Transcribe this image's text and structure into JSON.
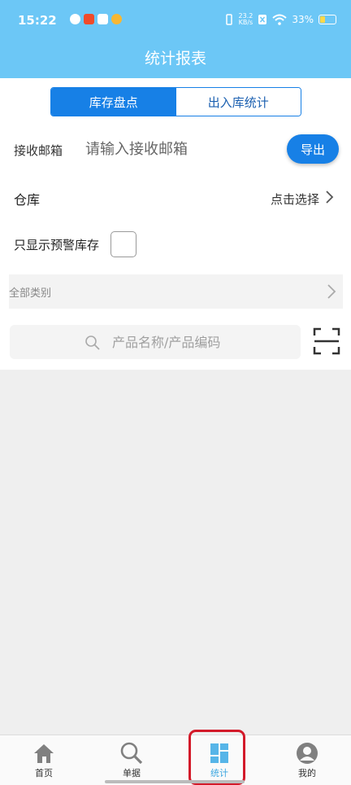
{
  "status_bar": {
    "time": "15:22",
    "network_speed_value": "23.2",
    "network_speed_unit": "KB/s",
    "battery": "33%"
  },
  "header": {
    "title": "统计报表"
  },
  "segments": {
    "tab1": "库存盘点",
    "tab2": "出入库统计",
    "active": "库存盘点"
  },
  "email": {
    "label": "接收邮箱",
    "placeholder": "请输入接收邮箱",
    "value": "",
    "export_label": "导出"
  },
  "warehouse": {
    "label": "仓库",
    "choose_text": "点击选择"
  },
  "warning_filter": {
    "label": "只显示预警库存",
    "checked": false
  },
  "category": {
    "label": "全部类别"
  },
  "search": {
    "placeholder": "产品名称/产品编码"
  },
  "tabbar": {
    "items": [
      {
        "label": "首页",
        "icon": "home-icon"
      },
      {
        "label": "单据",
        "icon": "search-icon"
      },
      {
        "label": "统计",
        "icon": "stats-icon",
        "active": true
      },
      {
        "label": "我的",
        "icon": "profile-icon"
      }
    ]
  },
  "colors": {
    "header": "#6cc7f6",
    "primary": "#1780e6",
    "active_tab": "#3aa6e0",
    "highlight": "#d31a2a"
  }
}
